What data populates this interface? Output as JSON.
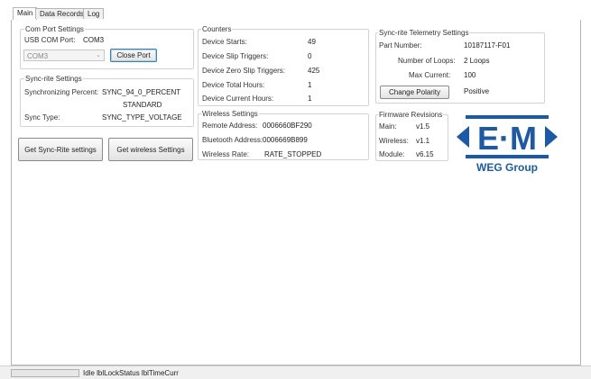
{
  "tabs": [
    {
      "label": "Main",
      "active": true
    },
    {
      "label": "Data Records",
      "active": false
    },
    {
      "label": "Log",
      "active": false
    }
  ],
  "com_port": {
    "title": "Com Port Settings",
    "usb_label": "USB COM Port:",
    "usb_value": "COM3",
    "combo_value": "COM3",
    "close_button": "Close Port"
  },
  "sync_settings": {
    "title": "Sync-rite Settings",
    "percent_label": "Synchronizing Percent:",
    "percent_value_line1": "SYNC_94_0_PERCENT",
    "percent_value_line2": "STANDARD",
    "type_label": "Sync Type:",
    "type_value": "SYNC_TYPE_VOLTAGE"
  },
  "buttons": {
    "get_syncrite": "Get Sync-Rite settings",
    "get_wireless": "Get wireless Settings",
    "change_polarity": "Change Polarity"
  },
  "counters": {
    "title": "Counters",
    "rows": [
      {
        "label": "Device Starts:",
        "value": "49"
      },
      {
        "label": "Device Slip Triggers:",
        "value": "0"
      },
      {
        "label": "Device Zero Slip Triggers:",
        "value": "425"
      },
      {
        "label": "Device Total Hours:",
        "value": "1"
      },
      {
        "label": "Device Current Hours:",
        "value": "1"
      }
    ]
  },
  "wireless": {
    "title": "Wireless Settings",
    "rows": [
      {
        "label": "Remote Address:",
        "value": "0006660BF290"
      },
      {
        "label": "Bluetooth Address:",
        "value": "0006669B899"
      },
      {
        "label": "Wireless Rate:",
        "value": "RATE_STOPPED"
      }
    ]
  },
  "telemetry": {
    "title": "Sync-rite Telemetry Settings",
    "part_label": "Part Number:",
    "part_value": "10187117-F01",
    "loops_label": "Number of Loops:",
    "loops_value": "2 Loops",
    "current_label": "Max Current:",
    "current_value": "100",
    "polarity_value": "Positive"
  },
  "firmware": {
    "title": "Firmware Revisions",
    "rows": [
      {
        "label": "Main:",
        "value": "v1.5"
      },
      {
        "label": "Wireless:",
        "value": "v1.1"
      },
      {
        "label": "Module:",
        "value": "v6.15"
      }
    ]
  },
  "logo": {
    "text": "E·M",
    "subtitle": "WEG Group",
    "color": "#1a5aa8"
  },
  "status": {
    "progress": 0,
    "text": "Idle  lblLockStatus  lblTimeCurr"
  }
}
